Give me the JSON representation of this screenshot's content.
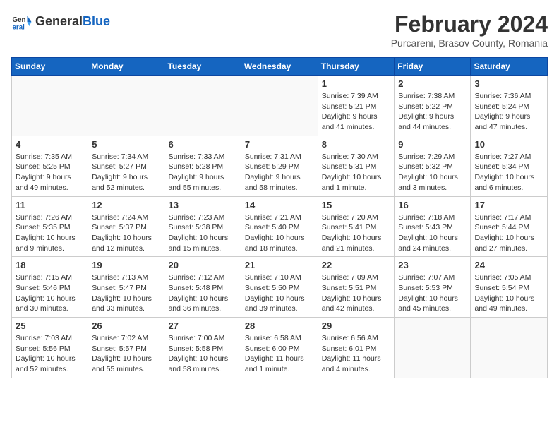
{
  "header": {
    "logo_general": "General",
    "logo_blue": "Blue",
    "title": "February 2024",
    "location": "Purcareni, Brasov County, Romania"
  },
  "weekdays": [
    "Sunday",
    "Monday",
    "Tuesday",
    "Wednesday",
    "Thursday",
    "Friday",
    "Saturday"
  ],
  "weeks": [
    [
      {
        "day": "",
        "info": ""
      },
      {
        "day": "",
        "info": ""
      },
      {
        "day": "",
        "info": ""
      },
      {
        "day": "",
        "info": ""
      },
      {
        "day": "1",
        "info": "Sunrise: 7:39 AM\nSunset: 5:21 PM\nDaylight: 9 hours and 41 minutes."
      },
      {
        "day": "2",
        "info": "Sunrise: 7:38 AM\nSunset: 5:22 PM\nDaylight: 9 hours and 44 minutes."
      },
      {
        "day": "3",
        "info": "Sunrise: 7:36 AM\nSunset: 5:24 PM\nDaylight: 9 hours and 47 minutes."
      }
    ],
    [
      {
        "day": "4",
        "info": "Sunrise: 7:35 AM\nSunset: 5:25 PM\nDaylight: 9 hours and 49 minutes."
      },
      {
        "day": "5",
        "info": "Sunrise: 7:34 AM\nSunset: 5:27 PM\nDaylight: 9 hours and 52 minutes."
      },
      {
        "day": "6",
        "info": "Sunrise: 7:33 AM\nSunset: 5:28 PM\nDaylight: 9 hours and 55 minutes."
      },
      {
        "day": "7",
        "info": "Sunrise: 7:31 AM\nSunset: 5:29 PM\nDaylight: 9 hours and 58 minutes."
      },
      {
        "day": "8",
        "info": "Sunrise: 7:30 AM\nSunset: 5:31 PM\nDaylight: 10 hours and 1 minute."
      },
      {
        "day": "9",
        "info": "Sunrise: 7:29 AM\nSunset: 5:32 PM\nDaylight: 10 hours and 3 minutes."
      },
      {
        "day": "10",
        "info": "Sunrise: 7:27 AM\nSunset: 5:34 PM\nDaylight: 10 hours and 6 minutes."
      }
    ],
    [
      {
        "day": "11",
        "info": "Sunrise: 7:26 AM\nSunset: 5:35 PM\nDaylight: 10 hours and 9 minutes."
      },
      {
        "day": "12",
        "info": "Sunrise: 7:24 AM\nSunset: 5:37 PM\nDaylight: 10 hours and 12 minutes."
      },
      {
        "day": "13",
        "info": "Sunrise: 7:23 AM\nSunset: 5:38 PM\nDaylight: 10 hours and 15 minutes."
      },
      {
        "day": "14",
        "info": "Sunrise: 7:21 AM\nSunset: 5:40 PM\nDaylight: 10 hours and 18 minutes."
      },
      {
        "day": "15",
        "info": "Sunrise: 7:20 AM\nSunset: 5:41 PM\nDaylight: 10 hours and 21 minutes."
      },
      {
        "day": "16",
        "info": "Sunrise: 7:18 AM\nSunset: 5:43 PM\nDaylight: 10 hours and 24 minutes."
      },
      {
        "day": "17",
        "info": "Sunrise: 7:17 AM\nSunset: 5:44 PM\nDaylight: 10 hours and 27 minutes."
      }
    ],
    [
      {
        "day": "18",
        "info": "Sunrise: 7:15 AM\nSunset: 5:46 PM\nDaylight: 10 hours and 30 minutes."
      },
      {
        "day": "19",
        "info": "Sunrise: 7:13 AM\nSunset: 5:47 PM\nDaylight: 10 hours and 33 minutes."
      },
      {
        "day": "20",
        "info": "Sunrise: 7:12 AM\nSunset: 5:48 PM\nDaylight: 10 hours and 36 minutes."
      },
      {
        "day": "21",
        "info": "Sunrise: 7:10 AM\nSunset: 5:50 PM\nDaylight: 10 hours and 39 minutes."
      },
      {
        "day": "22",
        "info": "Sunrise: 7:09 AM\nSunset: 5:51 PM\nDaylight: 10 hours and 42 minutes."
      },
      {
        "day": "23",
        "info": "Sunrise: 7:07 AM\nSunset: 5:53 PM\nDaylight: 10 hours and 45 minutes."
      },
      {
        "day": "24",
        "info": "Sunrise: 7:05 AM\nSunset: 5:54 PM\nDaylight: 10 hours and 49 minutes."
      }
    ],
    [
      {
        "day": "25",
        "info": "Sunrise: 7:03 AM\nSunset: 5:56 PM\nDaylight: 10 hours and 52 minutes."
      },
      {
        "day": "26",
        "info": "Sunrise: 7:02 AM\nSunset: 5:57 PM\nDaylight: 10 hours and 55 minutes."
      },
      {
        "day": "27",
        "info": "Sunrise: 7:00 AM\nSunset: 5:58 PM\nDaylight: 10 hours and 58 minutes."
      },
      {
        "day": "28",
        "info": "Sunrise: 6:58 AM\nSunset: 6:00 PM\nDaylight: 11 hours and 1 minute."
      },
      {
        "day": "29",
        "info": "Sunrise: 6:56 AM\nSunset: 6:01 PM\nDaylight: 11 hours and 4 minutes."
      },
      {
        "day": "",
        "info": ""
      },
      {
        "day": "",
        "info": ""
      }
    ]
  ]
}
